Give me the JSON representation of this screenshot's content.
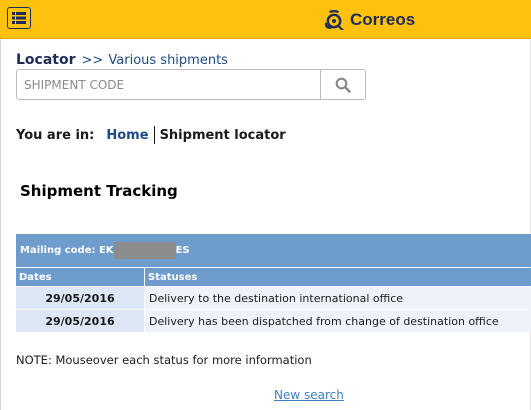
{
  "header": {
    "menu_icon": "list-icon",
    "brand_icon": "post-horn-icon",
    "brand_name": "Correos",
    "brand_color": "#fec20e",
    "brand_text_color": "#1d2b58"
  },
  "locator": {
    "title": "Locator",
    "separator": ">>",
    "subtitle": "Various shipments"
  },
  "search": {
    "placeholder": "SHIPMENT CODE",
    "value": "",
    "button_icon": "search-icon"
  },
  "breadcrumb": {
    "label": "You are in:",
    "home": "Home",
    "current": "Shipment locator"
  },
  "section_title": "Shipment Tracking",
  "tracking": {
    "mailing_code_label": "Mailing code:",
    "mailing_code_prefix": "EK",
    "mailing_code_suffix": "ES",
    "columns": [
      "Dates",
      "Statuses"
    ],
    "rows": [
      {
        "date": "29/05/2016",
        "status": "Delivery to the destination international office"
      },
      {
        "date": "29/05/2016",
        "status": "Delivery has been dispatched from change of destination office"
      }
    ],
    "header_color": "#6d9ccd"
  },
  "note": "NOTE: Mouseover each status for more information",
  "new_search": "New search"
}
